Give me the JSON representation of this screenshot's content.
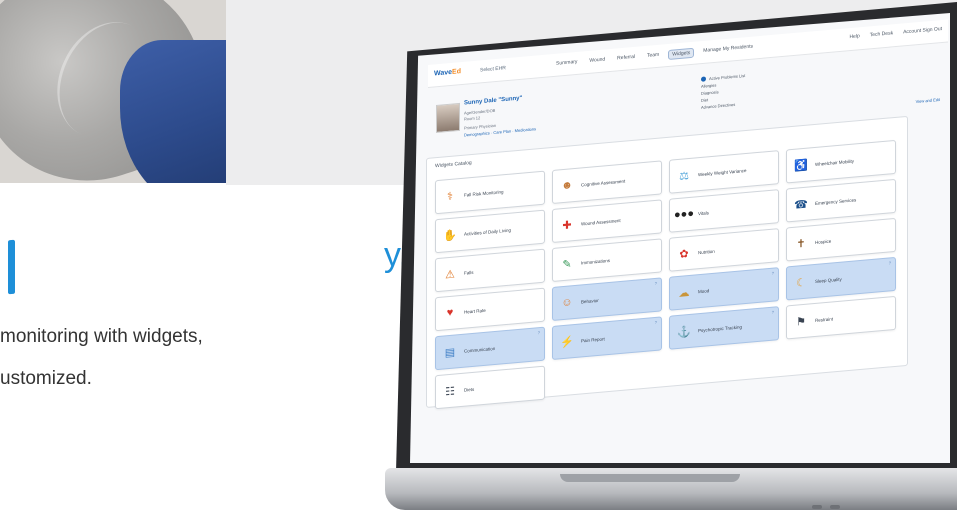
{
  "marketing": {
    "heading_fragment": "y.",
    "line1": "monitoring with widgets,",
    "line2": "ustomized."
  },
  "app": {
    "logo_main": "Wave",
    "logo_accent": "Ed",
    "subtitle": "Select EHR",
    "nav_tabs": [
      "Summary",
      "Wound",
      "Referral",
      "Team",
      "Widgets",
      "Manage My Residents"
    ],
    "active_tab_index": 4,
    "nav_right": [
      "Help",
      "Tech Desk",
      "Account Sign Out"
    ],
    "patient": {
      "name": "Sunny Dale \"Sunny\"",
      "line1": "Age/Gender/DOB",
      "line2": "Room 12",
      "line3": "Primary Physician",
      "links": "Demographics · Care Plan · Medications",
      "info": [
        "Active Problems List",
        "Allergies",
        "Diagnosis",
        "Diet",
        "Advance Directives"
      ],
      "edit_link": "View and Edit"
    },
    "widgets_panel_title": "Widgets Catalog",
    "widgets": [
      {
        "label": "Fall Risk Monitoring",
        "icon": "⚕",
        "color": "#e07b2c",
        "hl": false
      },
      {
        "label": "Cognitive Assessment",
        "icon": "☻",
        "color": "#c47a3a",
        "hl": false
      },
      {
        "label": "Weekly Weight Variance",
        "icon": "⚖",
        "color": "#4da3d9",
        "hl": false
      },
      {
        "label": "Wheelchair Mobility",
        "icon": "♿",
        "color": "#3b7cc4",
        "hl": false
      },
      {
        "label": "Activities of Daily Living",
        "icon": "✋",
        "color": "#e6a23c",
        "hl": false
      },
      {
        "label": "Wound Assessment",
        "icon": "✚",
        "color": "#d9342b",
        "hl": false
      },
      {
        "label": "Vitals",
        "icon": "●●●",
        "color": "#222222",
        "hl": false
      },
      {
        "label": "Emergency Services",
        "icon": "☎",
        "color": "#1b4f8a",
        "hl": false
      },
      {
        "label": "Falls",
        "icon": "⚠",
        "color": "#e07b2c",
        "hl": false
      },
      {
        "label": "Immunizations",
        "icon": "✎",
        "color": "#3a9a5b",
        "hl": false
      },
      {
        "label": "Nutrition",
        "icon": "✿",
        "color": "#d9342b",
        "hl": false
      },
      {
        "label": "Hospice",
        "icon": "✝",
        "color": "#8a5a2b",
        "hl": false
      },
      {
        "label": "Heart Rate",
        "icon": "♥",
        "color": "#d9342b",
        "hl": false
      },
      {
        "label": "Behavior",
        "icon": "☺",
        "color": "#e07b2c",
        "hl": true
      },
      {
        "label": "Mood",
        "icon": "☁",
        "color": "#c9953a",
        "hl": true
      },
      {
        "label": "Sleep Quality",
        "icon": "☾",
        "color": "#e6a23c",
        "hl": true
      },
      {
        "label": "Communication",
        "icon": "▤",
        "color": "#3b7cc4",
        "hl": true
      },
      {
        "label": "Pain Report",
        "icon": "⚡",
        "color": "#e07b2c",
        "hl": true
      },
      {
        "label": "Psychotropic Tracking",
        "icon": "⚓",
        "color": "#5a7a3a",
        "hl": true
      },
      {
        "label": "Restraint",
        "icon": "⚑",
        "color": "#3a4452",
        "hl": false
      },
      {
        "label": "Diets",
        "icon": "☷",
        "color": "#3a4452",
        "hl": false
      }
    ]
  }
}
